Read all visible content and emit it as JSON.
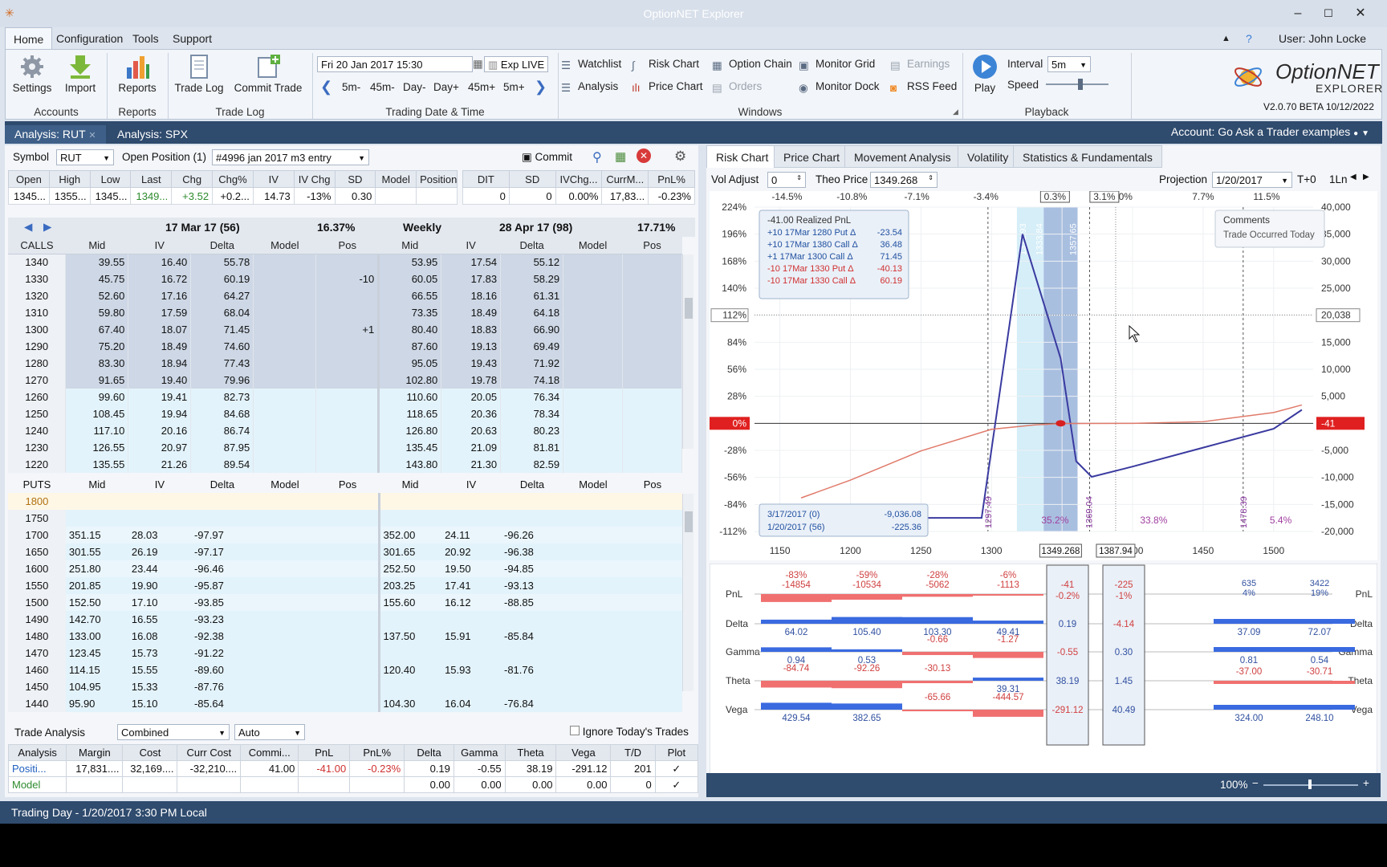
{
  "app": {
    "title": "OptionNET Explorer",
    "user": "User: John Locke",
    "logo_line1": "OptionNET",
    "logo_line2": "EXPLORER",
    "version": "V2.0.70 BETA 10/12/2022"
  },
  "menu": [
    "Home",
    "Configuration",
    "Tools",
    "Support"
  ],
  "ribbon": {
    "settings": "Settings",
    "import": "Import",
    "accounts": "Accounts",
    "reports": "Reports",
    "reports_group": "Reports",
    "trade_log": "Trade Log",
    "commit_trade": "Commit Trade",
    "trade_log_group": "Trade Log",
    "date": "Fri 20 Jan 2017 15:30",
    "exp": "Exp",
    "live": "LIVE",
    "steps": [
      "5m-",
      "45m-",
      "Day-",
      "Day+",
      "45m+",
      "5m+"
    ],
    "date_group": "Trading Date & Time",
    "windows": {
      "watchlist": "Watchlist",
      "analysis": "Analysis",
      "risk_chart": "Risk Chart",
      "price_chart": "Price Chart",
      "option_chain": "Option Chain",
      "orders": "Orders",
      "monitor_grid": "Monitor Grid",
      "monitor_dock": "Monitor Dock",
      "earnings": "Earnings",
      "rss": "RSS Feed",
      "group": "Windows"
    },
    "playback": {
      "play": "Play",
      "interval_label": "Interval",
      "interval": "5m",
      "speed": "Speed",
      "group": "Playback"
    }
  },
  "doc_tabs": [
    "Analysis: RUT",
    "Analysis: SPX"
  ],
  "account": "Account: Go Ask a Trader examples",
  "left": {
    "symbol_label": "Symbol",
    "symbol": "RUT",
    "open_pos_label": "Open Position (1)",
    "position": "#4996 jan 2017 m3 entry",
    "commit": "Commit",
    "quote_headers": [
      "Open",
      "High",
      "Low",
      "Last",
      "Chg",
      "Chg%",
      "IV",
      "IV Chg",
      "SD",
      "Model",
      "Position"
    ],
    "quote_values": [
      "1345...",
      "1355...",
      "1345...",
      "1349...",
      "+3.52",
      "+0.2...",
      "14.73",
      "-13%",
      "0.30",
      "",
      ""
    ],
    "pos_headers": [
      "DIT",
      "SD",
      "IVChg...",
      "CurrM...",
      "PnL%"
    ],
    "pos_values": [
      "0",
      "0",
      "0.00%",
      "17,83...",
      "-0.23%"
    ],
    "series1": {
      "name": "17 Mar 17 (56)",
      "iv": "16.37%"
    },
    "series2": {
      "weekly": "Weekly",
      "name": "28 Apr 17 (98)",
      "iv": "17.71%"
    },
    "calls_label": "CALLS",
    "puts_label": "PUTS",
    "cols": [
      "Mid",
      "IV",
      "Delta",
      "Model",
      "Pos"
    ],
    "calls": [
      [
        "1340",
        "39.55",
        "16.40",
        "55.78",
        "",
        "",
        "53.95",
        "17.54",
        "55.12",
        "",
        ""
      ],
      [
        "1330",
        "45.75",
        "16.72",
        "60.19",
        "",
        "-10",
        "60.05",
        "17.83",
        "58.29",
        "",
        ""
      ],
      [
        "1320",
        "52.60",
        "17.16",
        "64.27",
        "",
        "",
        "66.55",
        "18.16",
        "61.31",
        "",
        ""
      ],
      [
        "1310",
        "59.80",
        "17.59",
        "68.04",
        "",
        "",
        "73.35",
        "18.49",
        "64.18",
        "",
        ""
      ],
      [
        "1300",
        "67.40",
        "18.07",
        "71.45",
        "",
        "+1",
        "80.40",
        "18.83",
        "66.90",
        "",
        ""
      ],
      [
        "1290",
        "75.20",
        "18.49",
        "74.60",
        "",
        "",
        "87.60",
        "19.13",
        "69.49",
        "",
        ""
      ],
      [
        "1280",
        "83.30",
        "18.94",
        "77.43",
        "",
        "",
        "95.05",
        "19.43",
        "71.92",
        "",
        ""
      ],
      [
        "1270",
        "91.65",
        "19.40",
        "79.96",
        "",
        "",
        "102.80",
        "19.78",
        "74.18",
        "",
        ""
      ],
      [
        "1260",
        "99.60",
        "19.41",
        "82.73",
        "",
        "",
        "110.60",
        "20.05",
        "76.34",
        "",
        ""
      ],
      [
        "1250",
        "108.45",
        "19.94",
        "84.68",
        "",
        "",
        "118.65",
        "20.36",
        "78.34",
        "",
        ""
      ],
      [
        "1240",
        "117.10",
        "20.16",
        "86.74",
        "",
        "",
        "126.80",
        "20.63",
        "80.23",
        "",
        ""
      ],
      [
        "1230",
        "126.55",
        "20.97",
        "87.95",
        "",
        "",
        "135.45",
        "21.09",
        "81.81",
        "",
        ""
      ],
      [
        "1220",
        "135.55",
        "21.26",
        "89.54",
        "",
        "",
        "143.80",
        "21.30",
        "82.59",
        "",
        ""
      ]
    ],
    "puts": [
      [
        "1800",
        "",
        "",
        "",
        "",
        "",
        "",
        "",
        "",
        "",
        ""
      ],
      [
        "1750",
        "",
        "",
        "",
        "",
        "",
        "",
        "",
        "",
        "",
        ""
      ],
      [
        "1700",
        "351.15",
        "28.03",
        "-97.97",
        "",
        "",
        "352.00",
        "24.11",
        "-96.26",
        "",
        ""
      ],
      [
        "1650",
        "301.55",
        "26.19",
        "-97.17",
        "",
        "",
        "301.65",
        "20.92",
        "-96.38",
        "",
        ""
      ],
      [
        "1600",
        "251.80",
        "23.44",
        "-96.46",
        "",
        "",
        "252.50",
        "19.50",
        "-94.85",
        "",
        ""
      ],
      [
        "1550",
        "201.85",
        "19.90",
        "-95.87",
        "",
        "",
        "203.25",
        "17.41",
        "-93.13",
        "",
        ""
      ],
      [
        "1500",
        "152.50",
        "17.10",
        "-93.85",
        "",
        "",
        "155.60",
        "16.12",
        "-88.85",
        "",
        ""
      ],
      [
        "1490",
        "142.70",
        "16.55",
        "-93.23",
        "",
        "",
        "",
        "",
        "",
        "",
        ""
      ],
      [
        "1480",
        "133.00",
        "16.08",
        "-92.38",
        "",
        "",
        "137.50",
        "15.91",
        "-85.84",
        "",
        ""
      ],
      [
        "1470",
        "123.45",
        "15.73",
        "-91.22",
        "",
        "",
        "",
        "",
        "",
        "",
        ""
      ],
      [
        "1460",
        "114.15",
        "15.55",
        "-89.60",
        "",
        "",
        "120.40",
        "15.93",
        "-81.76",
        "",
        ""
      ],
      [
        "1450",
        "104.95",
        "15.33",
        "-87.76",
        "",
        "",
        "",
        "",
        "",
        "",
        ""
      ],
      [
        "1440",
        "95.90",
        "15.10",
        "-85.64",
        "",
        "",
        "104.30",
        "16.04",
        "-76.84",
        "",
        ""
      ]
    ],
    "trade_analysis_label": "Trade Analysis",
    "ta_mode": "Combined",
    "ta_auto": "Auto",
    "ignore_today": "Ignore Today's Trades",
    "ta_headers": [
      "Analysis",
      "Margin",
      "Cost",
      "Curr Cost",
      "Commi...",
      "PnL",
      "PnL%",
      "Delta",
      "Gamma",
      "Theta",
      "Vega",
      "T/D",
      "Plot"
    ],
    "ta_rows": [
      [
        "Positi...",
        "17,831....",
        "32,169....",
        "-32,210....",
        "41.00",
        "-41.00",
        "-0.23%",
        "0.19",
        "-0.55",
        "38.19",
        "-291.12",
        "201",
        "✓"
      ],
      [
        "Model",
        "",
        "",
        "",
        "",
        "",
        "",
        "0.00",
        "0.00",
        "0.00",
        "0.00",
        "0",
        "✓"
      ]
    ]
  },
  "right": {
    "tabs": [
      "Risk Chart",
      "Price Chart",
      "Movement Analysis",
      "Volatility",
      "Statistics & Fundamentals"
    ],
    "vol_adjust_label": "Vol Adjust",
    "vol_adjust": "0",
    "theo_label": "Theo Price",
    "theo": "1349.268",
    "projection_label": "Projection",
    "projection": "1/20/2017",
    "tplus": "T+0",
    "ln": "1Ln",
    "zoom": "100%"
  },
  "chart_data": {
    "type": "line",
    "x_ticks": [
      "1150",
      "1200",
      "1250",
      "1300",
      "1350",
      "1400",
      "1450",
      "1500"
    ],
    "xlim": [
      1132,
      1528
    ],
    "y_left_ticks": [
      "224%",
      "196%",
      "168%",
      "140%",
      "112%",
      "84%",
      "56%",
      "28%",
      "0%",
      "-28%",
      "-56%",
      "-84%",
      "-112%"
    ],
    "y_right_ticks": [
      "40,000",
      "35,000",
      "30,000",
      "25,000",
      "20,038",
      "15,000",
      "10,000",
      "5,000",
      "-41",
      "-5,000",
      "-10,000",
      "-15,000",
      "-20,000"
    ],
    "ylim": [
      -20000,
      40000
    ],
    "top_pct_ticks": [
      "-14.5%",
      "-10.8%",
      "-7.1%",
      "-3.4%",
      "0.3%",
      "3.1%",
      "0%",
      "7.7%",
      "11.5%"
    ],
    "current_price": "1349.268",
    "cursor_price": "1387.94",
    "vlines": [
      "1297.49",
      "1321.93",
      "1333.84",
      "1357.65",
      "1369.55",
      "1369.04",
      "1478.39"
    ],
    "bottom_pcts": [
      "35.2%",
      "33.8%",
      "5.4%"
    ],
    "series": [
      {
        "name": "3/17/2017 (0)",
        "color": "#3a3aa0",
        "x": [
          1162,
          1232,
          1293,
          1322,
          1349,
          1360,
          1371,
          1400,
          1450,
          1500,
          1520
        ],
        "y": [
          -17500,
          -17500,
          -17500,
          35000,
          12000,
          -7000,
          -9900,
          -8000,
          -4500,
          -1000,
          2500
        ]
      },
      {
        "name": "1/20/2017 (56)",
        "color": "#e07a6a",
        "x": [
          1165,
          1200,
          1250,
          1300,
          1330,
          1349,
          1370,
          1400,
          1450,
          1500,
          1520
        ],
        "y": [
          -13800,
          -10500,
          -5100,
          -1100,
          -300,
          -41,
          -20,
          -10,
          300,
          2000,
          3400
        ]
      }
    ],
    "legend_t1": "3/17/2017 (0)",
    "legend_t1_val": "-9,036.08",
    "legend_t0": "1/20/2017 (56)",
    "legend_t0_val": "-225.36",
    "tooltip": [
      "-41.00 Realized PnL",
      "+10 17Mar 1280 Put Δ",
      "-23.54",
      "+10 17Mar 1380 Call Δ",
      "36.48",
      "+1 17Mar 1300 Call Δ",
      "71.45",
      "-10 17Mar 1330 Put Δ",
      "-40.13",
      "-10 17Mar 1330 Call Δ",
      "60.19"
    ],
    "comments_title": "Comments",
    "comments_text": "Trade Occurred Today",
    "greeks": {
      "labels": [
        "PnL",
        "Delta",
        "Gamma",
        "Theta",
        "Vega"
      ],
      "pnl_pct": [
        "-83%",
        "-59%",
        "-28%",
        "-6%"
      ],
      "pnl": [
        "-14854",
        "-10534",
        "-5062",
        "-1113"
      ],
      "delta": [
        "64.02",
        "105.40",
        "103.30",
        "49.41"
      ],
      "gamma": [
        "0.94",
        "0.53",
        "-0.66",
        "-1.27"
      ],
      "theta": [
        "-84.74",
        "-92.26",
        "-30.13",
        "39.31"
      ],
      "vega": [
        "429.54",
        "382.65",
        "-65.66",
        "-444.57"
      ],
      "mid_col": [
        "-41",
        "-0.2%",
        "0.19",
        "-0.55",
        "38.19",
        "-291.12"
      ],
      "cursor_col": [
        "-225",
        "-1%",
        "-4.14",
        "0.30",
        "1.45",
        "40.49"
      ],
      "right_pnl": [
        "635",
        "4%",
        "3422",
        "19%"
      ],
      "right_delta": [
        "37.09",
        "72.07"
      ],
      "right_gamma": [
        "0.81",
        "0.54"
      ],
      "right_theta": [
        "-37.00",
        "-30.71"
      ],
      "right_vega": [
        "324.00",
        "248.10"
      ]
    }
  },
  "status": "Trading Day - 1/20/2017 3:30 PM Local"
}
